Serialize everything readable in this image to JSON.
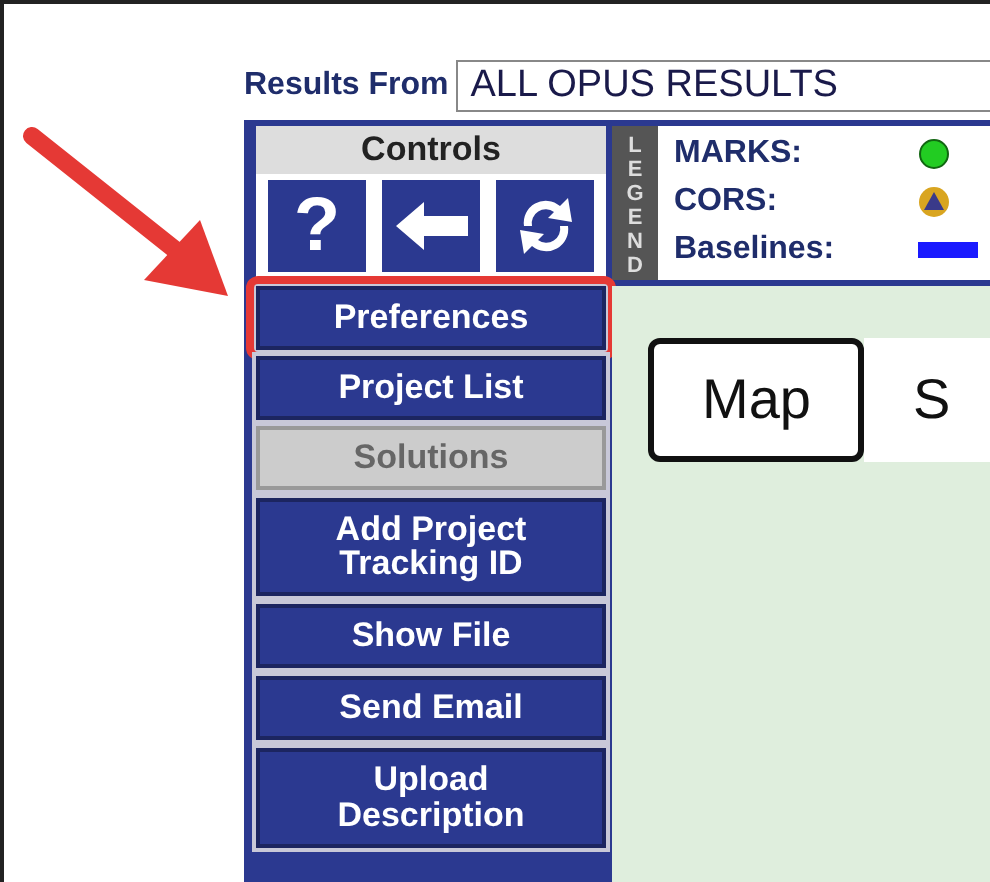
{
  "results_from": {
    "label": "Results From",
    "value": "ALL OPUS RESULTS"
  },
  "controls": {
    "title": "Controls",
    "icon_buttons": [
      {
        "kind": "help",
        "glyph": "?"
      },
      {
        "kind": "back"
      },
      {
        "kind": "refresh"
      }
    ],
    "button_groups": [
      {
        "buttons": [
          {
            "label": "Preferences",
            "disabled": false,
            "highlighted": true
          },
          {
            "label": "Project List",
            "disabled": false,
            "highlighted": false
          },
          {
            "label": "Solutions",
            "disabled": true,
            "highlighted": false
          }
        ]
      },
      {
        "buttons": [
          {
            "label": "Add Project Tracking ID",
            "disabled": false,
            "highlighted": false
          }
        ]
      },
      {
        "buttons": [
          {
            "label": "Show File",
            "disabled": false,
            "highlighted": false
          }
        ]
      },
      {
        "buttons": [
          {
            "label": "Send Email",
            "disabled": false,
            "highlighted": false
          }
        ]
      },
      {
        "buttons": [
          {
            "label": "Upload Description",
            "disabled": false,
            "highlighted": false
          }
        ]
      }
    ]
  },
  "legend": {
    "title": "LEGEND",
    "items": [
      {
        "label": "MARKS:",
        "kind": "dot",
        "color": "#22cc22"
      },
      {
        "label": "CORS:",
        "kind": "cors",
        "color": "#d9a520"
      },
      {
        "label": "Baselines:",
        "kind": "line",
        "color": "#1a1aff"
      }
    ]
  },
  "map": {
    "type_buttons": [
      {
        "label": "Map",
        "selected": true
      },
      {
        "label": "S",
        "selected": false
      }
    ]
  }
}
